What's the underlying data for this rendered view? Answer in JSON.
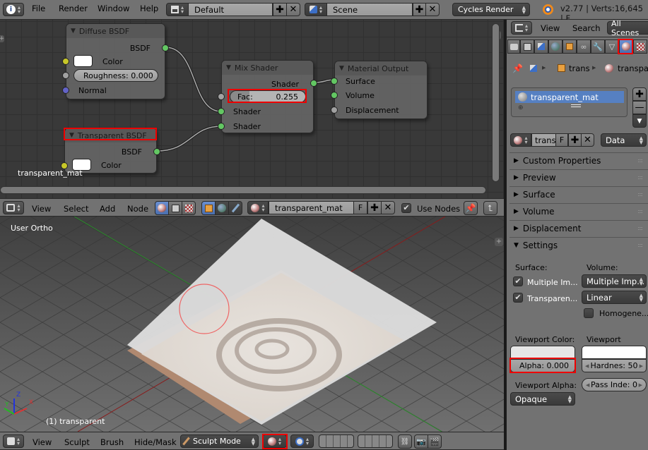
{
  "top_bar": {
    "menus": [
      "File",
      "Render",
      "Window",
      "Help"
    ],
    "layout_field": "Default",
    "scene_field": "Scene",
    "render_engine": "Cycles Render",
    "status": "v2.77 | Verts:16,645 | F"
  },
  "node_editor": {
    "nodes": {
      "diffuse": {
        "title": "Diffuse BSDF",
        "output": "BSDF",
        "color_label": "Color",
        "roughness": "Roughness: 0.000",
        "normal": "Normal"
      },
      "transparent": {
        "title": "Transparent BSDF",
        "output": "BSDF",
        "color_label": "Color"
      },
      "mix": {
        "title": "Mix Shader",
        "output": "Shader",
        "fac_label": "Fac:",
        "fac_value": "0.255",
        "fac": 0.255,
        "input1": "Shader",
        "input2": "Shader"
      },
      "output": {
        "title": "Material Output",
        "surface": "Surface",
        "volume": "Volume",
        "displacement": "Displacement"
      }
    },
    "material_name_overlay": "transparent_mat",
    "header": {
      "menus": [
        "View",
        "Select",
        "Add",
        "Node"
      ],
      "material_field": "transparent_mat",
      "fake_user": "F",
      "use_nodes_label": "Use Nodes",
      "use_nodes": true
    }
  },
  "viewport": {
    "view_label": "User Ortho",
    "object_label": "(1) transparent",
    "axes": {
      "x": "X",
      "y": "Y",
      "z": "Z"
    },
    "header": {
      "menus": [
        "View",
        "Sculpt",
        "Brush",
        "Hide/Mask"
      ],
      "mode": "Sculpt Mode"
    }
  },
  "properties": {
    "header": {
      "view": "View",
      "search": "Search",
      "scope": "All Scenes"
    },
    "breadcrumb": {
      "object": "trans",
      "material": "transpa"
    },
    "material_slots": [
      "transparent_mat"
    ],
    "material_selector": {
      "name": "trans",
      "fake_user": "F",
      "link": "Data"
    },
    "panels": [
      {
        "label": "Custom Properties",
        "open": false
      },
      {
        "label": "Preview",
        "open": false
      },
      {
        "label": "Surface",
        "open": false
      },
      {
        "label": "Volume",
        "open": false
      },
      {
        "label": "Displacement",
        "open": false
      },
      {
        "label": "Settings",
        "open": true
      }
    ],
    "settings": {
      "surface_label": "Surface:",
      "volume_label": "Volume:",
      "multiple_importance": "Multiple Im...",
      "multiple_importance_checked": true,
      "transparent_shadows": "Transparen...",
      "transparent_shadows_checked": true,
      "volume_sampling": "Multiple Imp...",
      "volume_interpolation": "Linear",
      "homogeneous": "Homogene...",
      "homogeneous_checked": false,
      "viewport_color_label": "Viewport Color:",
      "viewport_specular_label": "Viewport Spec...",
      "alpha": "Alpha: 0.000",
      "hardness": "Hardnes: 50",
      "viewport_alpha_label": "Viewport Alpha:",
      "pass_index": "Pass Inde: 0",
      "viewport_alpha_mode": "Opaque",
      "viewport_color": "#e6e6e6",
      "viewport_specular": "#ffffff"
    }
  },
  "colors": {
    "highlight": "#e00000",
    "selection": "#5680c2",
    "socket_shader": "#63c763",
    "socket_color": "#c7c729"
  }
}
